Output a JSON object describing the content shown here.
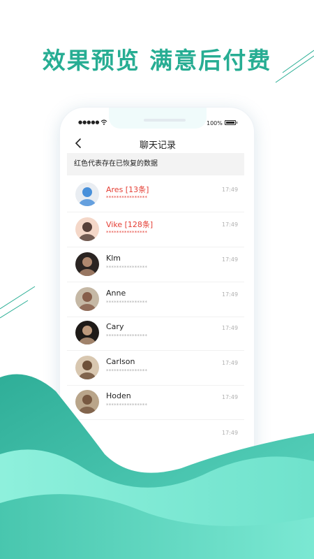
{
  "headline": "效果预览 满意后付费",
  "status_bar": {
    "signal": "●●●●●",
    "battery": "100%"
  },
  "nav": {
    "title": "聊天记录"
  },
  "banner": "红色代表存在已恢复的数据",
  "colors": {
    "accent": "#27ad93",
    "recovered_red": "#e43d33",
    "wave_light": "#7ee8d6",
    "wave_dark": "#2fae98"
  },
  "chats": [
    {
      "name": "Ares",
      "count": " [13条]",
      "preview": "****************",
      "time": "17:49",
      "recovered": true
    },
    {
      "name": "Vike",
      "count": " [128条]",
      "preview": "****************",
      "time": "17:49",
      "recovered": true
    },
    {
      "name": "Klm",
      "count": "",
      "preview": "****************",
      "time": "17:49",
      "recovered": false
    },
    {
      "name": "Anne",
      "count": "",
      "preview": "****************",
      "time": "17:49",
      "recovered": false
    },
    {
      "name": "Cary",
      "count": "",
      "preview": "****************",
      "time": "17:49",
      "recovered": false
    },
    {
      "name": "Carlson",
      "count": "",
      "preview": "****************",
      "time": "17:49",
      "recovered": false
    },
    {
      "name": "Hoden",
      "count": "",
      "preview": "****************",
      "time": "17:49",
      "recovered": false
    },
    {
      "name": "",
      "count": "",
      "preview": "",
      "time": "17:49",
      "recovered": false
    }
  ]
}
